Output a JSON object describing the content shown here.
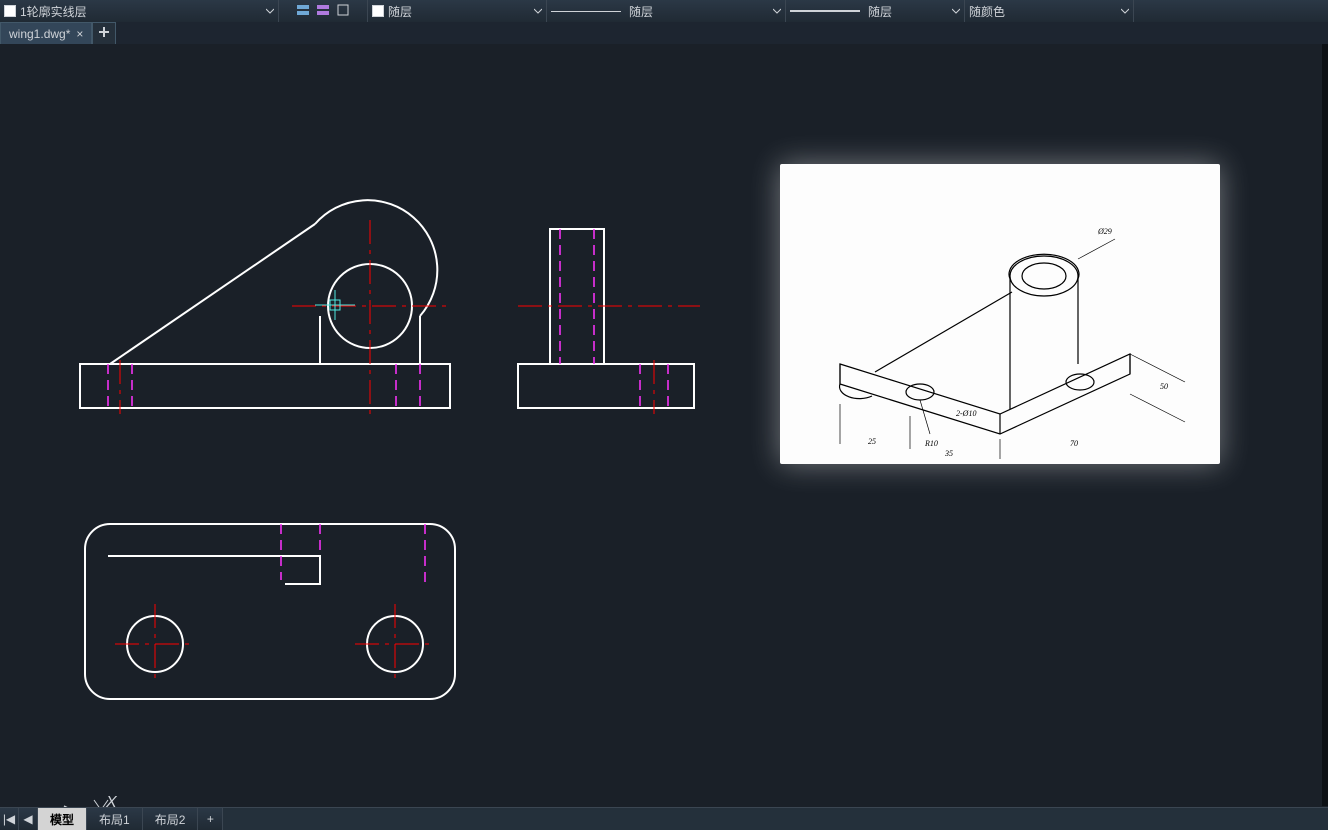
{
  "toolbar": {
    "layer": {
      "swatch": "#ffffff",
      "label": "1轮廓实线层"
    },
    "color": {
      "swatch": "#ffffff",
      "label": "随层"
    },
    "linetype": {
      "label": "随层"
    },
    "lineweight": {
      "label": "随层"
    },
    "plotstyle": {
      "label": "随颜色"
    }
  },
  "doctab": {
    "filename": "wing1.dwg*",
    "close_glyph": "×",
    "add_glyph": "+"
  },
  "bottom": {
    "nav_first": "|◀",
    "nav_prev": "◀",
    "tabs": [
      "模型",
      "布局1",
      "布局2"
    ],
    "active_index": 0,
    "add_glyph": "+"
  },
  "ucs": {
    "x_label": "X"
  },
  "ref_dims": {
    "a": "25",
    "b": "35",
    "c": "70",
    "d": "50",
    "r": "R10",
    "dia": "Ø29",
    "holes": "2-Ø10"
  }
}
